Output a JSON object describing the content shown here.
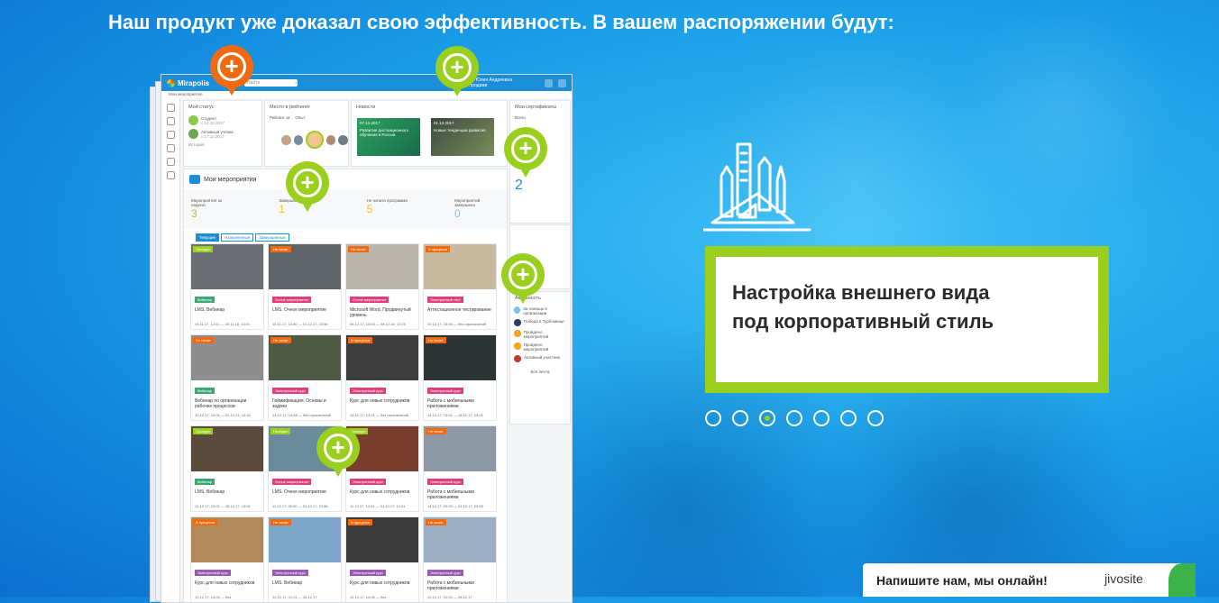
{
  "headline": "Наш продукт уже доказал свою эффективность. В вашем распоряжении будут:",
  "feature": {
    "text": "Настройка внешнего вида\nпод корпоративный стиль",
    "icon": "drafting-tools-icon"
  },
  "carousel": {
    "count": 7,
    "active_index": 2
  },
  "chat": {
    "message": "Напишите нам, мы онлайн!",
    "brand": "jivosite"
  },
  "colors": {
    "accent_green": "#9acf1e",
    "accent_orange": "#ef6a10",
    "brand_blue": "#1c8ed8"
  },
  "mockup": {
    "logo": "Mirapolis",
    "search_placeholder": "Найти",
    "user_name": "Иванова Юлия Андреевна",
    "user_role": "LMS, Продажи",
    "breadcrumb": "Мои мероприятия",
    "status": {
      "title": "Мой статус",
      "items": [
        {
          "label": "Студент",
          "date": "с 14.12.2017"
        },
        {
          "label": "Активный ученик",
          "date": "с 17.11.2017"
        }
      ],
      "history": "История"
    },
    "rating": {
      "title": "Место в рейтинге",
      "filter_label": "Рейтинг за",
      "filter_value": "Опыт"
    },
    "news": {
      "title": "Новости",
      "items": [
        {
          "date": "07.12.2017",
          "text": "Развитие дистанционного обучения в России"
        },
        {
          "date": "01.12.2017",
          "text": "Новые тенденции развития"
        }
      ]
    },
    "certificates": {
      "title": "Мои сертификаты",
      "all": "Всего",
      "count": "2"
    },
    "events": {
      "title": "Мои мероприятия",
      "stats": [
        {
          "label": "Мероприятия за неделю",
          "value": "3"
        },
        {
          "label": "Завершились",
          "value": "1"
        },
        {
          "label": "Не начата программа",
          "value": "5"
        },
        {
          "label": "Мероприятий завершено",
          "value": "0"
        }
      ]
    },
    "tabs": [
      "Текущие",
      "Назначенные",
      "Завершенные"
    ],
    "tiles": [
      {
        "badge": "Пройден",
        "tag": "Вебинар",
        "name": "LMS. Вебинар",
        "date": "14.11.17, 12:01 — 28.11.18, 13:01",
        "badge_color": "#9acf1e",
        "tag_color": "#3aa870",
        "img": "#6b6f74"
      },
      {
        "badge": "Не начат",
        "tag": "Очное мероприятие",
        "name": "LMS. Очное мероприятие",
        "date": "15.11.17, 12:00 — 01.12.17, 23:56",
        "badge_color": "#ef6a10",
        "tag_color": "#e0407a",
        "img": "#5e6468"
      },
      {
        "badge": "Не начат",
        "tag": "Очное мероприятие",
        "name": "Microsoft Word. Продвинутый уровень",
        "date": "08.12.17, 13:53 — 08.12.18, 12:25",
        "badge_color": "#ef6a10",
        "tag_color": "#e0407a",
        "img": "#b9b5ac"
      },
      {
        "badge": "В процессе",
        "tag": "Электронный тест",
        "name": "Аттестационное тестирование",
        "date": "10.12.17, 15:45 — без ограничений",
        "badge_color": "#ef6a10",
        "tag_color": "#e0407a",
        "img": "#c9b9a0"
      },
      {
        "badge": "Не начат",
        "tag": "Вебинар",
        "name": "Вебинар по организации рабочих процессов",
        "date": "10.12.17, 12:01 — 01.12.21, 14:34",
        "badge_color": "#ef6a10",
        "tag_color": "#3aa870",
        "img": "#8e8e8e"
      },
      {
        "badge": "Не начат",
        "tag": "Электронный курс",
        "name": "Геймификация. Основы и задачи",
        "date": "14.12.17, 14:58 — без ограничений",
        "badge_color": "#ef6a10",
        "tag_color": "#e0407a",
        "img": "#4f5a45"
      },
      {
        "badge": "В процессе",
        "tag": "Электронный курс",
        "name": "Курс для новых сотрудников",
        "date": "15.12.17, 12:01 — без ограничений",
        "badge_color": "#ef6a10",
        "tag_color": "#e0407a",
        "img": "#3d3d3d"
      },
      {
        "badge": "Не начат",
        "tag": "Электронный курс",
        "name": "Работа с мобильными приложениями",
        "date": "14.12.17, 13:01 — 18.12.17, 15:01",
        "badge_color": "#ef6a10",
        "tag_color": "#e0407a",
        "img": "#2d3436"
      },
      {
        "badge": "Пройден",
        "tag": "Вебинар",
        "name": "LMS. Вебинар",
        "date": "12.12.17, 12:01 — 28.12.17, 13:01",
        "badge_color": "#9acf1e",
        "tag_color": "#3aa870",
        "img": "#5b4b3c"
      },
      {
        "badge": "Пройден",
        "tag": "Очное мероприятие",
        "name": "LMS. Очное мероприятие",
        "date": "11.12.17, 00:00 — 31.12.17, 23:56",
        "badge_color": "#9acf1e",
        "tag_color": "#e0407a",
        "img": "#6b8b9a"
      },
      {
        "badge": "Пройден",
        "tag": "Электронный курс",
        "name": "Курс для новых сотрудников",
        "date": "11.12.17, 12:01 — 01.12.17, 12:01",
        "badge_color": "#9acf1e",
        "tag_color": "#e0407a",
        "img": "#7a3e2e"
      },
      {
        "badge": "Не начат",
        "tag": "Электронный курс",
        "name": "Работа с мобильными приложениями",
        "date": "14.12.17, 00:00 — 21.12.17, 23:59",
        "badge_color": "#ef6a10",
        "tag_color": "#e0407a",
        "img": "#8d9aa6"
      },
      {
        "badge": "В процессе",
        "tag": "Электронный курс",
        "name": "Курс для новых сотрудников",
        "date": "12.12.17, 14:00 — без",
        "badge_color": "#ef6a10",
        "tag_color": "#9b59b6",
        "img": "#b08a5b"
      },
      {
        "badge": "Не начат",
        "tag": "Электронный курс",
        "name": "LMS. Вебинар",
        "date": "12.12.17, 12:01 — 28.12.17",
        "badge_color": "#ef6a10",
        "tag_color": "#9b59b6",
        "img": "#7ea6c9"
      },
      {
        "badge": "В процессе",
        "tag": "Электронный курс",
        "name": "Курс для новых сотрудников",
        "date": "12.12.17, 14:00 — без",
        "badge_color": "#ef6a10",
        "tag_color": "#9b59b6",
        "img": "#3a3a3a"
      },
      {
        "badge": "Не начат",
        "tag": "Электронный курс",
        "name": "Работа с мобильными приложениями",
        "date": "12.12.17, 10:00 — 28.12.17",
        "badge_color": "#ef6a10",
        "tag_color": "#9b59b6",
        "img": "#9bb0c4"
      }
    ],
    "activity": {
      "title": "Активность",
      "items": [
        "За помощь в организации",
        "Победа в Турбомище",
        "Пройдено мероприятий",
        "Пройдено мероприятий",
        "Активный участник"
      ],
      "all": "Вся лента"
    }
  }
}
